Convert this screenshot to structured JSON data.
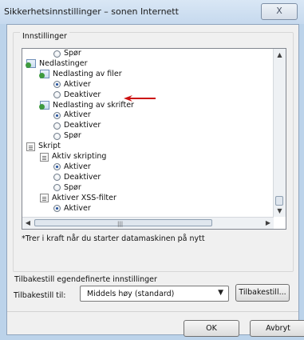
{
  "window": {
    "title": "Sikkerhetsinnstillinger – sonen Internett",
    "close_label": "X"
  },
  "settings": {
    "group_label": "Innstillinger",
    "items": [
      {
        "type": "radio",
        "label": "Spør",
        "checked": false,
        "indent": 2
      },
      {
        "type": "folder",
        "label": "Nedlastinger",
        "indent": 0
      },
      {
        "type": "folder",
        "label": "Nedlasting av filer",
        "indent": 1
      },
      {
        "type": "radio",
        "label": "Aktiver",
        "checked": true,
        "indent": 2
      },
      {
        "type": "radio",
        "label": "Deaktiver",
        "checked": false,
        "indent": 2
      },
      {
        "type": "folder",
        "label": "Nedlasting av skrifter",
        "indent": 1
      },
      {
        "type": "radio",
        "label": "Aktiver",
        "checked": true,
        "indent": 2
      },
      {
        "type": "radio",
        "label": "Deaktiver",
        "checked": false,
        "indent": 2
      },
      {
        "type": "radio",
        "label": "Spør",
        "checked": false,
        "indent": 2
      },
      {
        "type": "script",
        "label": "Skript",
        "indent": 0
      },
      {
        "type": "script",
        "label": "Aktiv skripting",
        "indent": 1
      },
      {
        "type": "radio",
        "label": "Aktiver",
        "checked": true,
        "indent": 2
      },
      {
        "type": "radio",
        "label": "Deaktiver",
        "checked": false,
        "indent": 2
      },
      {
        "type": "radio",
        "label": "Spør",
        "checked": false,
        "indent": 2
      },
      {
        "type": "script",
        "label": "Aktiver XSS-filter",
        "indent": 1
      },
      {
        "type": "radio",
        "label": "Aktiver",
        "checked": true,
        "indent": 2
      }
    ],
    "note": "*Trer i kraft når du starter datamaskinen på nytt"
  },
  "reset": {
    "label": "Tilbakestill egendefinerte innstillinger",
    "to_label": "Tilbakestill til:",
    "selected": "Middels høy (standard)",
    "button": "Tilbakestill..."
  },
  "footer": {
    "ok": "OK",
    "cancel": "Avbryt"
  },
  "colors": {
    "annotation_arrow": "#cc1111",
    "title_bar": "#c6d9ee",
    "client_bg": "#f0f0f0"
  }
}
